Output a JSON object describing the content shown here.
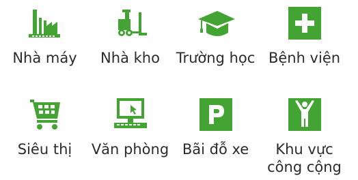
{
  "accent_color": "#43a434",
  "text_color": "#2b2b2b",
  "tiles": [
    {
      "icon": "factory-icon",
      "label": "Nhà máy"
    },
    {
      "icon": "forklift-warehouse-icon",
      "label": "Nhà kho"
    },
    {
      "icon": "graduation-cap-icon",
      "label": "Trường học"
    },
    {
      "icon": "hospital-cross-icon",
      "label": "Bệnh viện"
    },
    {
      "icon": "shopping-cart-icon",
      "label": "Siêu thị"
    },
    {
      "icon": "computer-monitor-icon",
      "label": "Văn phòng"
    },
    {
      "icon": "parking-sign-icon",
      "label": "Bãi đỗ xe"
    },
    {
      "icon": "public-space-person-icon",
      "label_line1": "Khu vực",
      "label_line2": "công cộng"
    }
  ]
}
